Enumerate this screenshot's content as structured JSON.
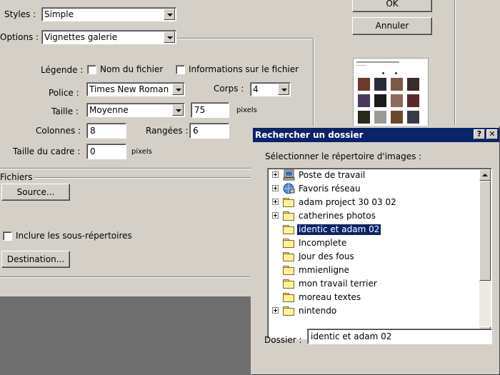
{
  "main_dialog": {
    "styles_label": "Styles :",
    "styles_value": "Simple",
    "options_label": "Options :",
    "options_value": "Vignettes galerie",
    "legende_label": "Légende :",
    "nom_fichier_label": "Nom du fichier",
    "nom_fichier_checked": false,
    "info_fichier_label": "Informations sur le fichier",
    "info_fichier_checked": false,
    "police_label": "Police :",
    "police_value": "Times New Roman",
    "corps_label": "Corps :",
    "corps_value": "4",
    "taille_label": "Taille :",
    "taille_value": "Moyenne",
    "taille_pixels_value": "75",
    "pixels_unit": "pixels",
    "colonnes_label": "Colonnes :",
    "colonnes_value": "8",
    "rangees_label": "Rangées :",
    "rangees_value": "6",
    "taille_cadre_label": "Taille du cadre :",
    "taille_cadre_value": "0",
    "fichiers_label": "Fichiers",
    "source_button": "Source...",
    "include_subdirs_label": "Inclure les sous-répertoires",
    "include_subdirs_checked": false,
    "destination_button": "Destination...",
    "ok_button": "OK",
    "annuler_button": "Annuler"
  },
  "folder_dialog": {
    "title": "Rechercher un dossier",
    "help_button": "?",
    "close_button": "✕",
    "prompt": "Sélectionner le répertoire d'images :",
    "tree_items": [
      {
        "label": "Poste de travail",
        "icon": "computer-icon",
        "expandable": true
      },
      {
        "label": "Favoris réseau",
        "icon": "network-icon",
        "expandable": true
      },
      {
        "label": "adam project 30 03 02",
        "icon": "folder-icon",
        "expandable": true
      },
      {
        "label": "catherines photos",
        "icon": "folder-icon",
        "expandable": true
      },
      {
        "label": "identic et adam 02",
        "icon": "folder-open-icon",
        "expandable": false,
        "selected": true
      },
      {
        "label": "Incomplete",
        "icon": "folder-icon",
        "expandable": false
      },
      {
        "label": "Jour des fous",
        "icon": "folder-icon",
        "expandable": false
      },
      {
        "label": "mmienligne",
        "icon": "folder-icon",
        "expandable": false
      },
      {
        "label": "mon travail terrier",
        "icon": "folder-icon",
        "expandable": false
      },
      {
        "label": "moreau textes",
        "icon": "folder-icon",
        "expandable": false
      },
      {
        "label": "nintendo",
        "icon": "folder-icon",
        "expandable": true
      }
    ],
    "dossier_label": "Dossier :",
    "dossier_value": "identic et adam 02"
  },
  "colors": {
    "dialog_bg": "#d4d0c8",
    "titlebar": "#0a246a",
    "desktop": "#6f6f6f",
    "selection": "#0a246a"
  }
}
